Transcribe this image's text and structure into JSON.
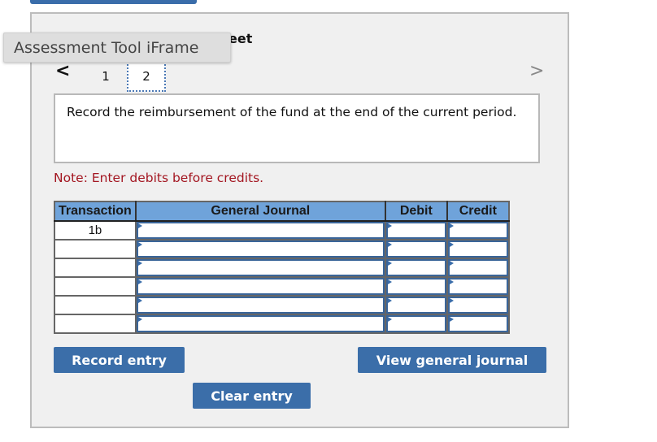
{
  "tooltip": "Assessment Tool iFrame",
  "sheet_title_fragment": "eet",
  "nav": {
    "prev_icon": "chevron-left-icon",
    "next_icon": "chevron-right-icon",
    "prev_glyph": "<",
    "next_glyph": ">",
    "tabs": [
      {
        "label": "1",
        "selected": false
      },
      {
        "label": "2",
        "selected": true
      }
    ]
  },
  "question": "Record the reimbursement of the fund at the end of the current period.",
  "note": "Note: Enter debits before credits.",
  "journal": {
    "headers": {
      "transaction": "Transaction",
      "general_journal": "General Journal",
      "debit": "Debit",
      "credit": "Credit"
    },
    "rows": [
      {
        "transaction": "1b",
        "account": "",
        "debit": "",
        "credit": ""
      },
      {
        "transaction": "",
        "account": "",
        "debit": "",
        "credit": ""
      },
      {
        "transaction": "",
        "account": "",
        "debit": "",
        "credit": ""
      },
      {
        "transaction": "",
        "account": "",
        "debit": "",
        "credit": ""
      },
      {
        "transaction": "",
        "account": "",
        "debit": "",
        "credit": ""
      },
      {
        "transaction": "",
        "account": "",
        "debit": "",
        "credit": ""
      }
    ]
  },
  "buttons": {
    "record": "Record entry",
    "view": "View general journal",
    "clear": "Clear entry"
  },
  "colors": {
    "accent": "#3b6ea9",
    "header_bg": "#6fa3da",
    "note_red": "#a31621",
    "panel_bg": "#f0f0f0"
  }
}
